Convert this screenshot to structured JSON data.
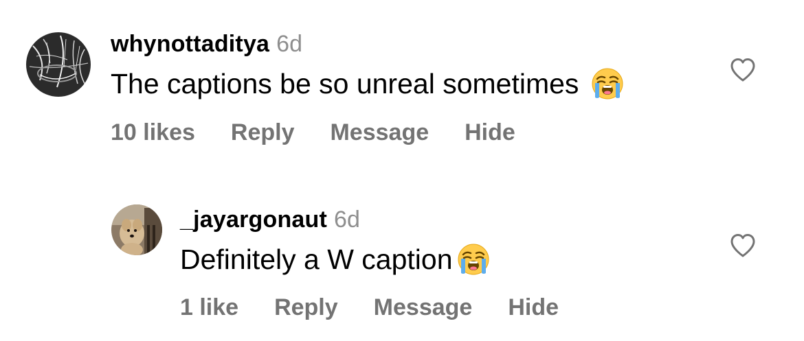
{
  "comments": [
    {
      "username": "whynottaditya",
      "time": "6d",
      "text": "The captions be so unreal sometimes",
      "emoji": "loudly-crying-face",
      "likes": "10 likes",
      "reply": "Reply",
      "message": "Message",
      "hide": "Hide",
      "avatar": "avatar-sketch-art",
      "heart": "heart-outline-icon"
    },
    {
      "username": "_jayargonaut",
      "time": "6d",
      "text": "Definitely a W caption",
      "emoji": "loudly-crying-face",
      "likes": "1 like",
      "reply": "Reply",
      "message": "Message",
      "hide": "Hide",
      "avatar": "avatar-dog-photo",
      "heart": "heart-outline-icon"
    }
  ],
  "colors": {
    "text": "#000000",
    "secondary": "#737373",
    "timestamp": "#8e8e8e",
    "background": "#ffffff"
  }
}
